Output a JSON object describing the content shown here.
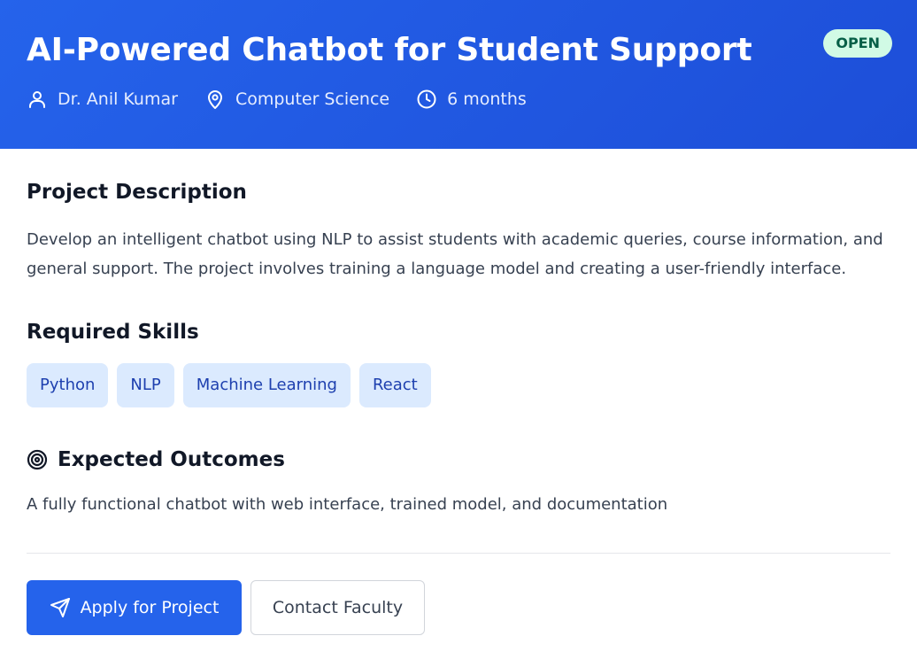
{
  "project": {
    "title": "AI-Powered Chatbot for Student Support",
    "status": "OPEN",
    "faculty": "Dr. Anil Kumar",
    "department": "Computer Science",
    "duration": "6 months"
  },
  "description": {
    "heading": "Project Description",
    "text": "Develop an intelligent chatbot using NLP to assist students with academic queries, course information, and general support. The project involves training a language model and creating a user-friendly interface."
  },
  "skills": {
    "heading": "Required Skills",
    "items": [
      "Python",
      "NLP",
      "Machine Learning",
      "React"
    ]
  },
  "outcomes": {
    "heading": "Expected Outcomes",
    "text": "A fully functional chatbot with web interface, trained model, and documentation"
  },
  "actions": {
    "apply_label": "Apply for Project",
    "contact_label": "Contact Faculty"
  },
  "icons": {
    "faculty": "user-icon",
    "department": "map-pin-icon",
    "duration": "clock-icon",
    "outcomes": "target-icon",
    "apply": "send-icon"
  },
  "colors": {
    "header_bg": "#2563eb",
    "badge_bg": "#d1fae5",
    "badge_text": "#065f46",
    "skill_bg": "#dbeafe",
    "skill_text": "#1e40af",
    "primary_button": "#2563eb"
  }
}
